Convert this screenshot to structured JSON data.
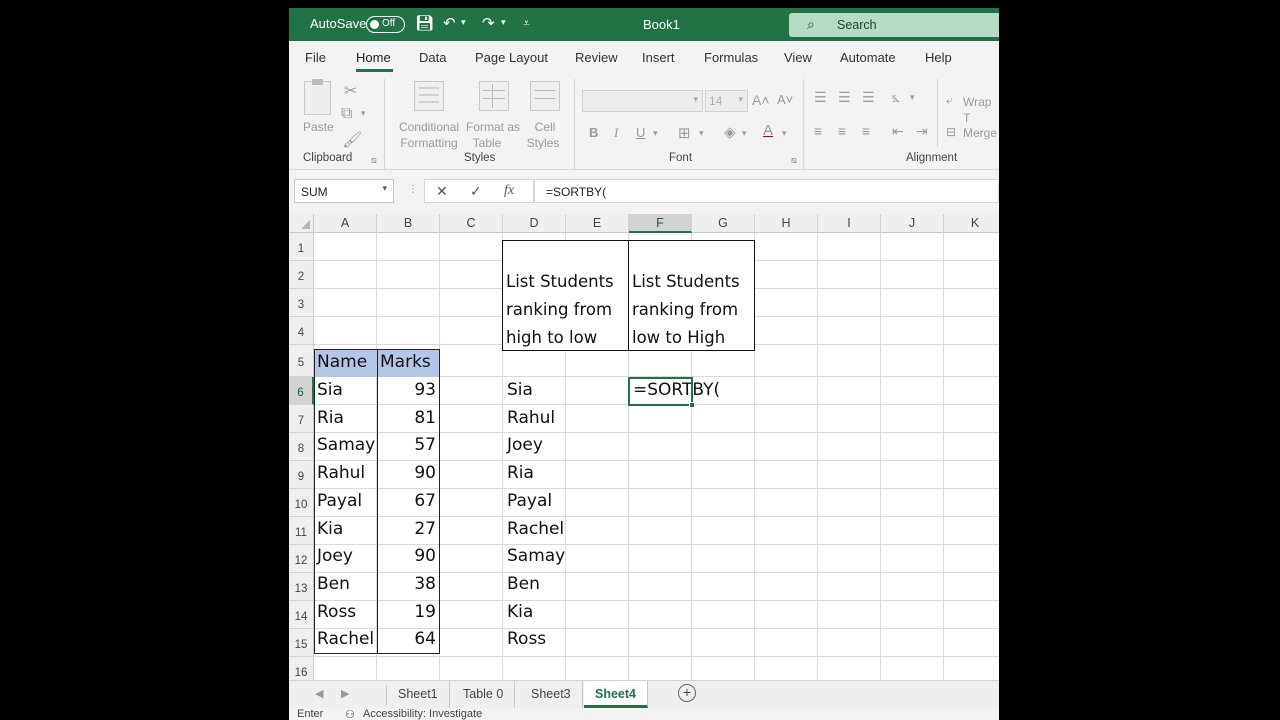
{
  "titlebar": {
    "autosave_label": "AutoSave",
    "autosave_state": "Off",
    "book_name": "Book1",
    "search_label": "Search"
  },
  "menu": {
    "tabs": [
      "File",
      "Home",
      "Data",
      "Page Layout",
      "Review",
      "Insert",
      "Formulas",
      "View",
      "Automate",
      "Help"
    ],
    "active": "Home"
  },
  "ribbon": {
    "clipboard": {
      "paste": "Paste",
      "label": "Clipboard"
    },
    "styles": {
      "conditional_1": "Conditional",
      "conditional_2": "Formatting",
      "format_1": "Format as",
      "format_2": "Table",
      "cell_1": "Cell",
      "cell_2": "Styles",
      "label": "Styles"
    },
    "font": {
      "size": "14",
      "bold": "B",
      "italic": "I",
      "underline": "U",
      "label": "Font"
    },
    "alignment": {
      "wrap": "Wrap T",
      "merge": "Merge",
      "label": "Alignment"
    }
  },
  "formula_bar": {
    "name_box": "SUM",
    "formula": "=SORTBY("
  },
  "columns": [
    "A",
    "B",
    "C",
    "D",
    "E",
    "F",
    "G",
    "H",
    "I",
    "J",
    "K"
  ],
  "rows": [
    "1",
    "2",
    "3",
    "4",
    "5",
    "6",
    "7",
    "8",
    "9",
    "10",
    "11",
    "12",
    "13",
    "14",
    "15",
    "16"
  ],
  "table": {
    "headers": [
      "Name",
      "Marks"
    ],
    "rows": [
      [
        "Sia",
        "93"
      ],
      [
        "Ria",
        "81"
      ],
      [
        "Samay",
        "57"
      ],
      [
        "Rahul",
        "90"
      ],
      [
        "Payal",
        "67"
      ],
      [
        "Kia",
        "27"
      ],
      [
        "Joey",
        "90"
      ],
      [
        "Ben",
        "38"
      ],
      [
        "Ross",
        "19"
      ],
      [
        "Rachel",
        "64"
      ]
    ]
  },
  "box_high_to_low": {
    "text": "List Students\nranking from\nhigh to low"
  },
  "box_low_to_high": {
    "text": "List Students\nranking from\nlow to High"
  },
  "sorted_list": [
    "Sia",
    "Rahul",
    "Joey",
    "Ria",
    "Payal",
    "Rachel",
    "Samay",
    "Ben",
    "Kia",
    "Ross"
  ],
  "active_cell": {
    "text": "=SORTBY("
  },
  "sheets": [
    "Sheet1",
    "Table 0",
    "Sheet3",
    "Sheet4"
  ],
  "active_sheet": "Sheet4",
  "status": {
    "mode": "Enter",
    "accessibility": "Accessibility: Investigate"
  }
}
